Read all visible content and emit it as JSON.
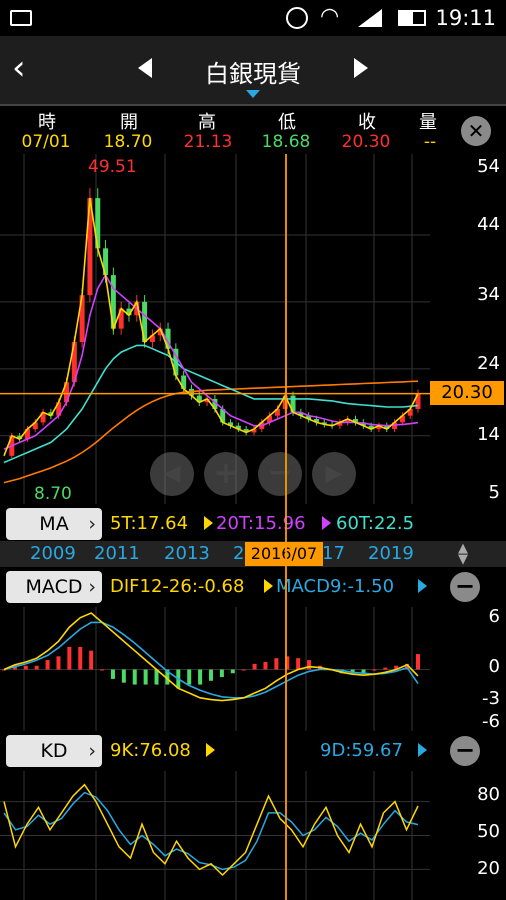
{
  "status": {
    "time": "19:11"
  },
  "header": {
    "title": "白銀現貨"
  },
  "ohlc_bar": {
    "labels": [
      "時",
      "開",
      "高",
      "低",
      "收",
      "量"
    ],
    "values": [
      "07/01",
      "18.70",
      "21.13",
      "18.68",
      "20.30",
      "--"
    ],
    "colors": [
      "#ffd700",
      "#ffd700",
      "#ff3030",
      "#4cd964",
      "#ff3030",
      "#ffd700"
    ]
  },
  "main_chart": {
    "high_label": "49.51",
    "low_label": "8.70",
    "last_price": "20.30",
    "y_ticks": [
      "54",
      "44",
      "34",
      "24",
      "14",
      "5"
    ]
  },
  "ma_legend": {
    "button": "MA",
    "ma5": "5T:17.64",
    "ma20": "20T:15.96",
    "ma60": "60T:22.5"
  },
  "timeline": {
    "years": [
      "2009",
      "2011",
      "2013",
      "2",
      "17",
      "2019"
    ],
    "cursor_date": "2016/07"
  },
  "macd_legend": {
    "button": "MACD",
    "dif": "DIF12-26:-0.68",
    "macd": "MACD9:-1.50",
    "y_ticks": [
      "6",
      "0",
      "-3",
      "-6"
    ]
  },
  "kd_legend": {
    "button": "KD",
    "k": "9K:76.08",
    "d": "9D:59.67",
    "y_ticks": [
      "80",
      "50",
      "20"
    ]
  },
  "chart_data": {
    "type": "line",
    "title": "白銀現貨",
    "x_axis_years": [
      "2009",
      "2011",
      "2013",
      "2015",
      "2017",
      "2019"
    ],
    "ylim": [
      5,
      54
    ],
    "close": [
      11,
      14,
      13.5,
      15,
      16,
      17.5,
      17,
      19,
      22,
      28,
      35,
      49.5,
      42,
      38,
      30,
      33,
      32,
      34,
      28,
      29,
      30,
      27,
      23,
      21,
      20,
      19,
      19.5,
      18,
      16,
      15.5,
      15,
      14.5,
      15,
      16,
      17,
      18,
      20,
      17.5,
      17,
      16.5,
      16,
      15.7,
      15.5,
      16,
      16.5,
      16,
      15.5,
      15,
      15.5,
      15,
      16,
      17,
      18,
      20.3
    ],
    "ma20": [
      12,
      12.5,
      13,
      13.5,
      14,
      15,
      16,
      17,
      19,
      22,
      26,
      32,
      36,
      38,
      36,
      35,
      34,
      33,
      32,
      31,
      30,
      28,
      26,
      24,
      22,
      21,
      20,
      19,
      18,
      17,
      16.5,
      16,
      15.5,
      15.5,
      16,
      16.5,
      17,
      17.5,
      17.5,
      17,
      16.8,
      16.5,
      16.2,
      16,
      16,
      16,
      15.9,
      15.7,
      15.6,
      15.5,
      15.6,
      15.7,
      15.8,
      15.96
    ],
    "ma60": [
      10,
      10.5,
      11,
      11.5,
      12,
      12.5,
      13,
      14,
      15,
      16.5,
      18,
      20,
      22,
      24,
      25.5,
      26.5,
      27,
      27.5,
      27.5,
      27,
      26.5,
      26,
      25,
      24,
      23.5,
      23,
      22.5,
      22,
      21.5,
      21,
      20.5,
      20,
      19.5,
      19.5,
      19.5,
      19.5,
      19.5,
      19.5,
      19.5,
      19.5,
      19.4,
      19.3,
      19.2,
      19,
      18.8,
      18.7,
      18.6,
      18.5,
      18.4,
      18.3,
      18.3,
      18.3,
      18.4,
      18.5
    ],
    "ma240": [
      7,
      7.3,
      7.6,
      8,
      8.4,
      8.8,
      9.2,
      9.7,
      10.2,
      10.8,
      11.5,
      12.3,
      13.2,
      14.2,
      15.2,
      16.1,
      17,
      17.8,
      18.5,
      19.1,
      19.6,
      20,
      20.3,
      20.5,
      20.6,
      20.7,
      20.8,
      20.85,
      20.9,
      20.95,
      21,
      21.05,
      21.1,
      21.15,
      21.2,
      21.25,
      21.3,
      21.35,
      21.4,
      21.45,
      21.5,
      21.55,
      21.6,
      21.65,
      21.7,
      21.75,
      21.8,
      21.85,
      21.9,
      21.95,
      22,
      22.05,
      22.1,
      22.15
    ],
    "macd": {
      "ylim": [
        -6,
        6
      ],
      "dif": [
        0,
        0.5,
        0.8,
        1.2,
        2,
        3,
        4.5,
        5.5,
        6,
        5,
        4,
        3,
        2,
        1,
        0,
        -1,
        -2,
        -2.5,
        -3,
        -3.2,
        -3.3,
        -3.2,
        -3,
        -2.5,
        -2,
        -1.2,
        -0.5,
        0,
        0.3,
        0.2,
        0,
        -0.3,
        -0.5,
        -0.6,
        -0.5,
        -0.3,
        0,
        0.5,
        -0.68
      ],
      "signal": [
        0,
        0.3,
        0.6,
        1,
        1.5,
        2.3,
        3.3,
        4.3,
        5,
        5,
        4.5,
        3.7,
        2.8,
        1.8,
        0.8,
        -0.2,
        -1,
        -1.7,
        -2.2,
        -2.6,
        -2.9,
        -3,
        -3,
        -2.8,
        -2.4,
        -1.8,
        -1.2,
        -0.6,
        -0.2,
        0,
        0,
        -0.1,
        -0.3,
        -0.4,
        -0.5,
        -0.4,
        -0.2,
        0.2,
        -1.5
      ]
    },
    "kd": {
      "ylim": [
        0,
        100
      ],
      "k": [
        80,
        40,
        60,
        75,
        55,
        70,
        85,
        95,
        80,
        60,
        40,
        30,
        60,
        35,
        25,
        45,
        30,
        20,
        25,
        15,
        25,
        35,
        60,
        85,
        65,
        55,
        40,
        60,
        75,
        50,
        35,
        60,
        40,
        70,
        80,
        55,
        76.08
      ],
      "d": [
        70,
        55,
        58,
        68,
        60,
        65,
        78,
        88,
        84,
        72,
        55,
        42,
        50,
        42,
        32,
        38,
        34,
        26,
        24,
        20,
        22,
        28,
        45,
        70,
        70,
        62,
        50,
        55,
        66,
        58,
        45,
        52,
        46,
        60,
        72,
        62,
        59.67
      ]
    }
  }
}
